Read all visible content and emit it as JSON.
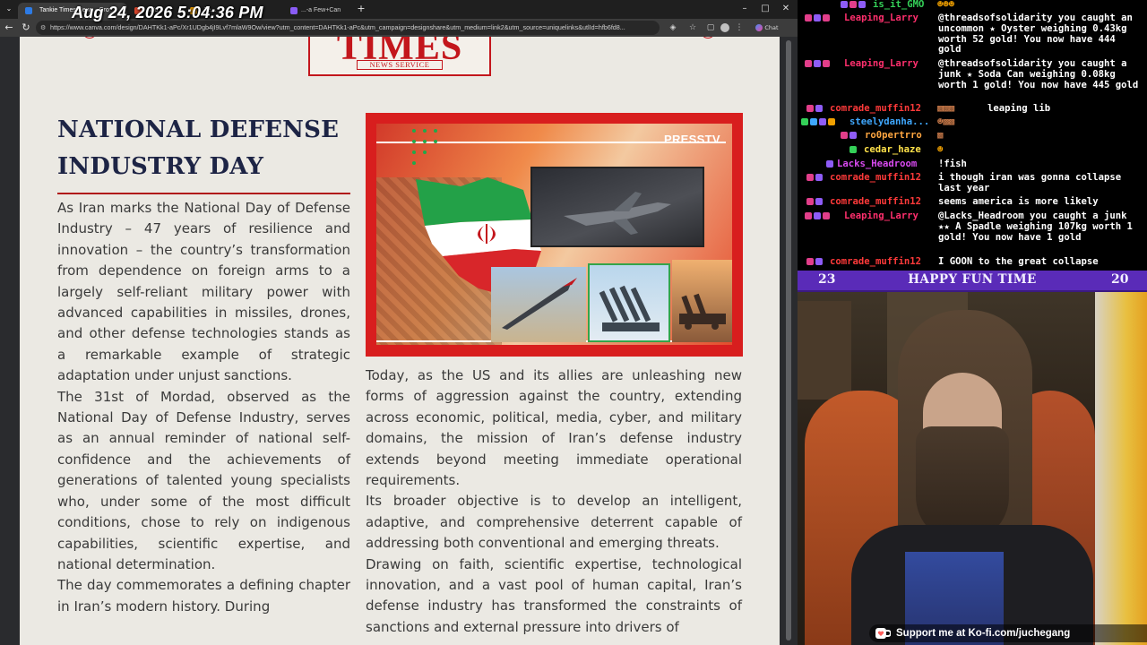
{
  "overlay": {
    "clock": "Aug 24, 2026 5:04:36 PM"
  },
  "browser": {
    "tabs": [
      {
        "label": "Tankie Times News - Cro",
        "color": "#2d7be5"
      },
      {
        "label": "Wo...",
        "color": "#d9452c"
      },
      {
        "label": "Te...",
        "color": "#f0a000"
      },
      {
        "label": "...-a Few+Can",
        "color": "#8a5cf6"
      }
    ],
    "url": "https://www.canva.com/design/DAHTKk1-aPc/Xr1UDgb4jI9Lvf7mlaW9Ow/view?utm_content=DAHTKk1-aPc&utm_campaign=designshare&utm_medium=link2&utm_source=uniquelinks&utlId=hfb6fd8...",
    "chat_button": "Chat"
  },
  "article": {
    "masthead_title": "TIMES",
    "masthead_sub": "NEWS SERVICE",
    "headline": "NATIONAL DEFENSE INDUSTRY DAY",
    "image_brand": "PRESSTV",
    "left_paragraphs": [
      "As Iran marks the National Day of Defense Industry – 47 years of resilience and innovation – the country’s transformation from dependence on foreign arms to a largely self-reliant military power with advanced capabilities in missiles, drones, and other defense technologies stands as a remarkable example of strategic adaptation under unjust sanctions.",
      "The 31st of Mordad, observed as the National Day of Defense Industry, serves as an annual reminder of national self-confidence and the achievements of generations of talented young specialists who, under some of the most difficult conditions, chose to rely on indigenous capabilities, scientific expertise, and national determination.",
      "The day commemorates a defining chapter in Iran’s modern history. During"
    ],
    "right_paragraphs": [
      "Today, as the US and its allies are unleashing new forms of aggression against the country, extending across economic, political, media, cyber, and military domains, the mission of Iran’s defense industry extends beyond meeting immediate operational requirements.",
      "Its broader objective is to develop an intelligent, adaptive, and comprehensive deterrent capable of addressing both conventional and emerging threats.",
      "Drawing on faith, scientific expertise, technological innovation, and a vast pool of human capital, Iran’s defense industry has transformed the constraints of sanctions and external pressure into drivers of"
    ]
  },
  "chat": {
    "messages": [
      {
        "user": "is_it_GMO",
        "color": "#34d058",
        "text": "",
        "badges": [
          "#8e5cf7",
          "#e23e8a",
          "#8e5cf7"
        ]
      },
      {
        "user": "Leaping_Larry",
        "color": "#ff2f6d",
        "text": "@threadsofsolidarity you caught an uncommon ★ Oyster weighing 0.43kg worth 52 gold! You now have 444 gold",
        "badges": [
          "#e23e8a",
          "#8e5cf7",
          "#e23e8a"
        ]
      },
      {
        "user": "Leaping_Larry",
        "color": "#ff2f6d",
        "text": "@threadsofsolidarity you caught a junk ★ Soda Can weighing 0.08kg worth 1 gold! You now have 445 gold",
        "badges": [
          "#e23e8a",
          "#8e5cf7",
          "#e23e8a"
        ]
      },
      {
        "user": "comrade_muffin12",
        "color": "#ff3a3a",
        "text": "leaping lib",
        "badges": [
          "#e23e8a",
          "#8e5cf7"
        ]
      },
      {
        "user": "steelydanha...",
        "color": "#3fa8ff",
        "text": "",
        "badges": [
          "#34d058",
          "#3fa8ff",
          "#8e5cf7",
          "#f0a000"
        ]
      },
      {
        "user": "ro0pertrro",
        "color": "#ffa640",
        "text": "",
        "badges": [
          "#e23e8a",
          "#8e5cf7"
        ]
      },
      {
        "user": "cedar_haze",
        "color": "#ffe24a",
        "text": "",
        "badges": [
          "#34d058"
        ]
      },
      {
        "user": "Lacks_Headroom",
        "color": "#d84af0",
        "text": "!fish",
        "badges": [
          "#8e5cf7"
        ]
      },
      {
        "user": "comrade_muffin12",
        "color": "#ff3a3a",
        "text": "i though iran was gonna collapse last year",
        "badges": [
          "#e23e8a",
          "#8e5cf7"
        ]
      },
      {
        "user": "comrade_muffin12",
        "color": "#ff3a3a",
        "text": "seems america is more likely",
        "badges": [
          "#e23e8a",
          "#8e5cf7"
        ]
      },
      {
        "user": "Leaping_Larry",
        "color": "#ff2f6d",
        "text": "@Lacks_Headroom you caught a junk ★★ A Spadle weighing 107kg worth 1 gold! You now have 1 gold",
        "badges": [
          "#e23e8a",
          "#8e5cf7",
          "#e23e8a"
        ]
      },
      {
        "user": "comrade_muffin12",
        "color": "#ff3a3a",
        "text": "I GOON to the great collapse",
        "badges": [
          "#e23e8a",
          "#8e5cf7"
        ]
      }
    ]
  },
  "banner": {
    "title": "HAPPY FUN TIME",
    "left_number": "23",
    "right_number": "20"
  },
  "kofi": {
    "text": "Support me at Ko-fi.com/juchegang"
  }
}
